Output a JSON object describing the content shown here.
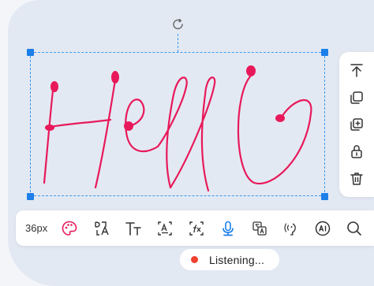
{
  "editor": {
    "font_size_label": "36px",
    "ink_color": "#e8195a",
    "selection_color": "#3d97f0"
  },
  "side_toolbar": {
    "items": [
      {
        "icon": "bring-to-front-icon"
      },
      {
        "icon": "duplicate-icon"
      },
      {
        "icon": "add-copy-icon"
      },
      {
        "icon": "lock-icon"
      },
      {
        "icon": "delete-icon"
      }
    ]
  },
  "bottom_toolbar": {
    "items": [
      {
        "icon": "palette-icon"
      },
      {
        "icon": "font-case-icon"
      },
      {
        "icon": "text-size-icon"
      },
      {
        "icon": "text-recognition-icon"
      },
      {
        "icon": "formula-icon"
      },
      {
        "icon": "microphone-icon",
        "active": true
      },
      {
        "icon": "translate-icon"
      },
      {
        "icon": "speech-icon"
      },
      {
        "icon": "ai-icon"
      },
      {
        "icon": "search-icon"
      }
    ]
  },
  "status": {
    "listening_label": "Listening...",
    "indicator_color": "#f04030"
  }
}
